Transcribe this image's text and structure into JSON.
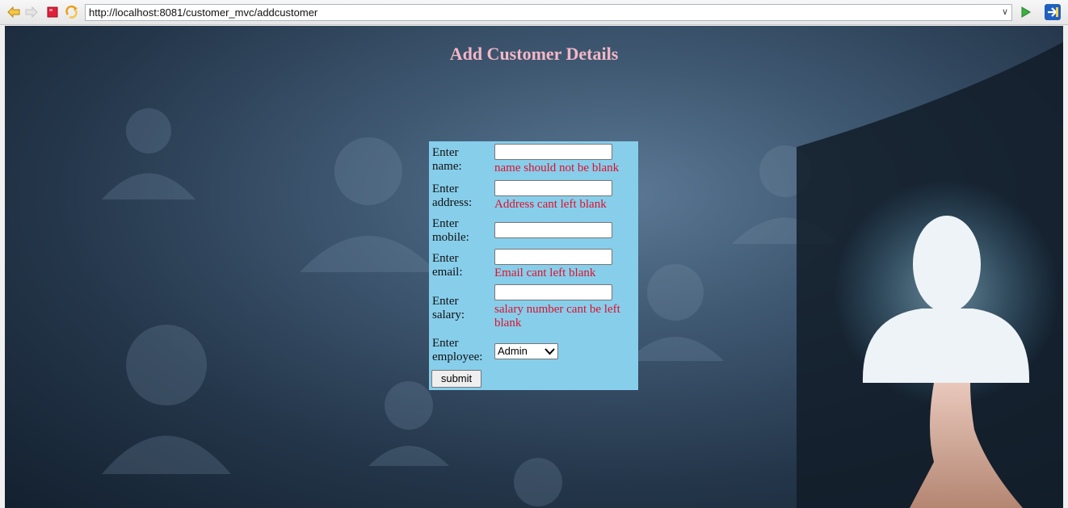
{
  "browser": {
    "url": "http://localhost:8081/customer_mvc/addcustomer",
    "icons": [
      "back-icon",
      "forward-icon",
      "stop-icon",
      "refresh-icon",
      "dropdown-icon",
      "go-icon",
      "open-external-icon"
    ]
  },
  "page": {
    "title": "Add Customer Details",
    "title_color": "#f4b7c6",
    "form_background": "#87ceeb",
    "error_color": "#e0102a"
  },
  "form": {
    "name": {
      "label_line1": "Enter",
      "label_line2": "name:",
      "value": "",
      "error": "name should not be blank"
    },
    "address": {
      "label_line1": "Enter",
      "label_line2": "address:",
      "value": "",
      "error": "Address cant left blank"
    },
    "mobile": {
      "label_line1": "Enter",
      "label_line2": "mobile:",
      "value": "",
      "error": ""
    },
    "email": {
      "label_line1": "Enter",
      "label_line2": "email:",
      "value": "",
      "error": "Email cant left blank"
    },
    "salary": {
      "label_line1": "Enter",
      "label_line2": "salary:",
      "value": "",
      "error_line1": "salary number cant be left",
      "error_line2": "blank"
    },
    "employee": {
      "label_line1": "Enter",
      "label_line2": "employee:",
      "selected": "Admin"
    },
    "submit_label": "submit"
  }
}
